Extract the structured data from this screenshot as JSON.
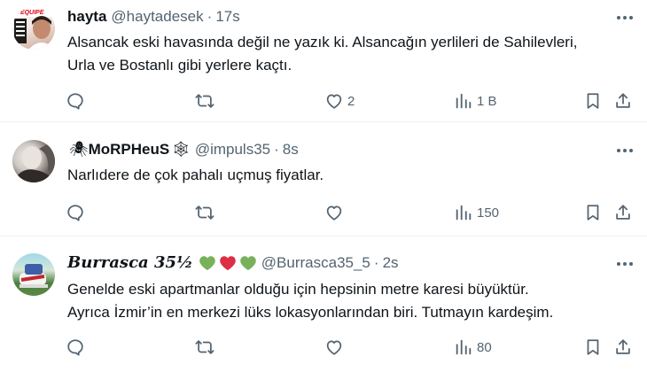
{
  "tweets": [
    {
      "name": "hayta",
      "handle": "@haytadesek",
      "dot": "·",
      "time": "17s",
      "text_lines": [
        "Alsancak eski havasında değil ne yazık ki. Alsancağın yerlileri de Sahilevleri,",
        "Urla ve Bostanlı gibi yerlere kaçtı."
      ],
      "likes": "2",
      "views": "1 B",
      "avatar_text": "L'ÉQUIPE"
    },
    {
      "name_prefix": "🕷",
      "name": "MoRPHeuS",
      "name_suffix": "🕸",
      "handle": "@impuls35",
      "dot": "·",
      "time": "8s",
      "text_lines": [
        "Narlıdere de çok pahalı uçmuş fiyatlar."
      ],
      "likes": "",
      "views": "150"
    },
    {
      "name": "Burrasca 35½",
      "handle": "@Burrasca35_5",
      "dot": "·",
      "time": "2s",
      "heart_colors": [
        "#78b159",
        "#dd2e44",
        "#78b159"
      ],
      "text_lines": [
        "Genelde eski apartmanlar olduğu için hepsinin metre karesi büyüktür.",
        "Ayrıca İzmir’in en merkezi lüks lokasyonlarından biri. Tutmayın kardeşim."
      ],
      "likes": "",
      "views": "80"
    }
  ],
  "colors": {
    "text": "#0f1419",
    "secondary": "#536471",
    "divider": "#eff3f4"
  }
}
